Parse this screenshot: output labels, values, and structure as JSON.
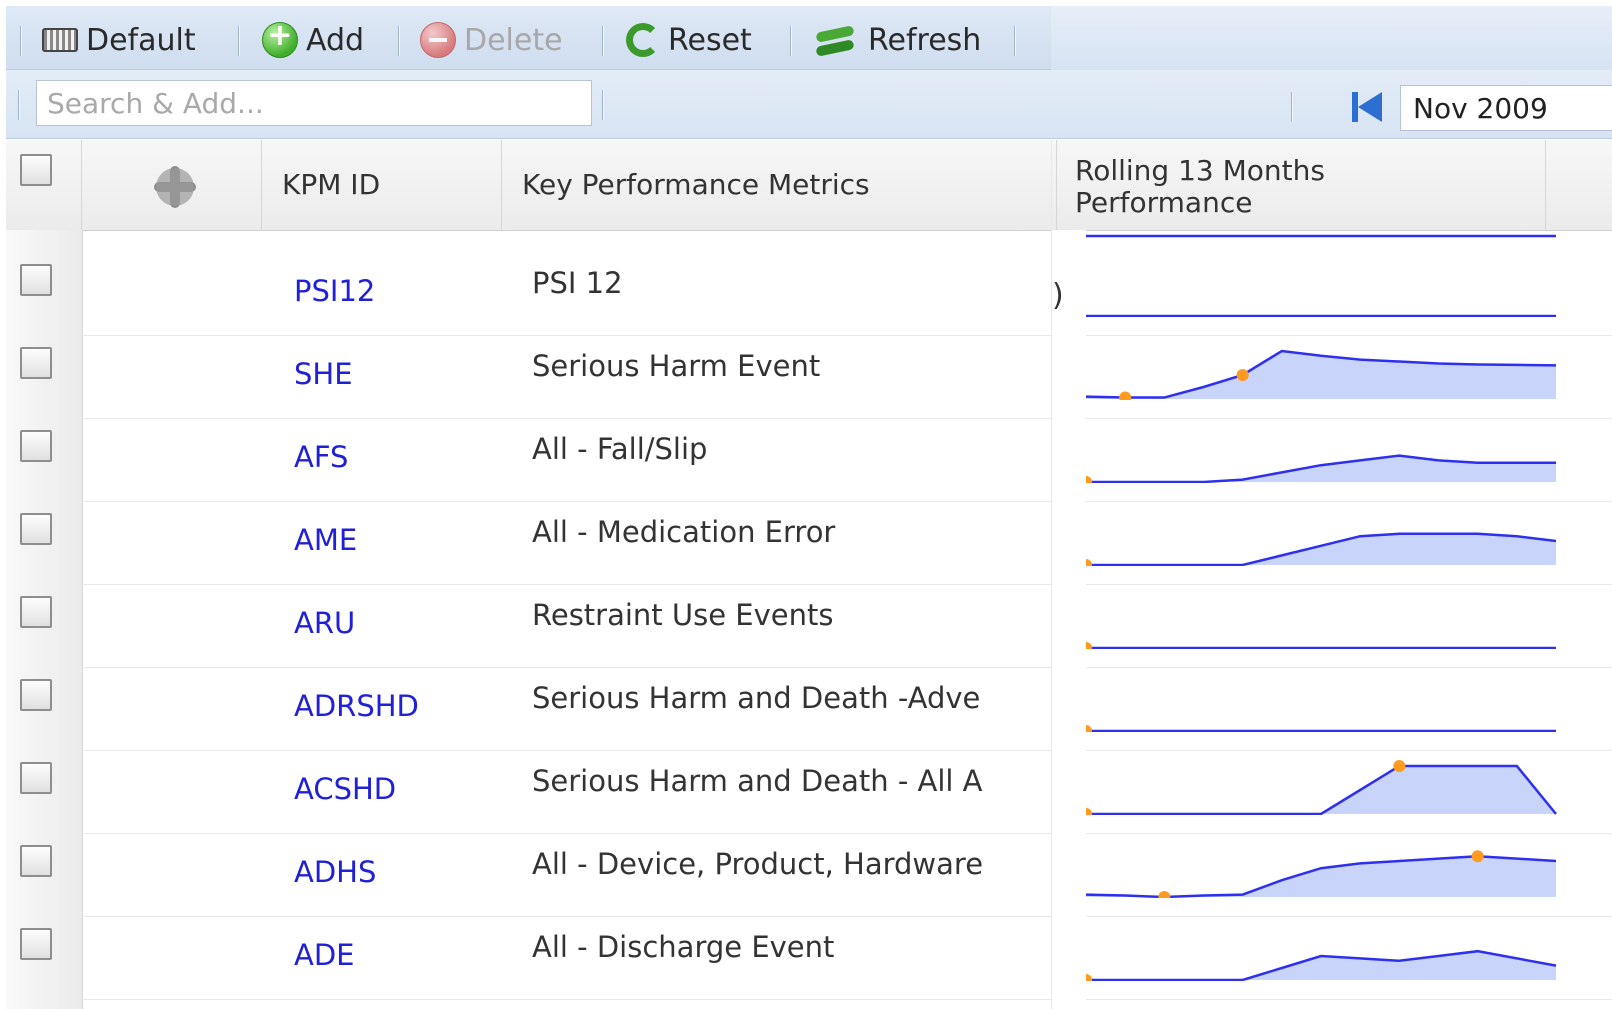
{
  "toolbar": {
    "default_label": "Default",
    "add_label": "Add",
    "delete_label": "Delete",
    "reset_label": "Reset",
    "refresh_label": "Refresh"
  },
  "search": {
    "placeholder": "Search & Add..."
  },
  "period": {
    "value": "Nov 2009"
  },
  "columns": {
    "kpm_id": "KPM ID",
    "metric": "Key Performance Metrics",
    "trend_line1": "Rolling 13 Months",
    "trend_line2": "Performance"
  },
  "stray_char": ")",
  "rows": [
    {
      "id": "PSI12",
      "name": "PSI 12",
      "trend": [
        0,
        0,
        0,
        0,
        0,
        0,
        0,
        0,
        0,
        0,
        0,
        0,
        0
      ],
      "markers": []
    },
    {
      "id": "SHE",
      "name": "Serious Harm Event",
      "trend": [
        0.05,
        0.03,
        0.03,
        0.25,
        0.5,
        1.0,
        0.9,
        0.82,
        0.78,
        0.74,
        0.72,
        0.71,
        0.7
      ],
      "markers": [
        1,
        4
      ]
    },
    {
      "id": "AFS",
      "name": "All - Fall/Slip",
      "trend": [
        0,
        0,
        0,
        0,
        0.05,
        0.2,
        0.35,
        0.45,
        0.55,
        0.45,
        0.4,
        0.4,
        0.4
      ],
      "markers": [
        0
      ]
    },
    {
      "id": "AME",
      "name": "All - Medication Error",
      "trend": [
        0,
        0,
        0,
        0,
        0,
        0.2,
        0.4,
        0.6,
        0.65,
        0.65,
        0.65,
        0.6,
        0.5
      ],
      "markers": [
        0
      ]
    },
    {
      "id": "ARU",
      "name": "Restraint Use Events",
      "trend": [
        0,
        0,
        0,
        0,
        0,
        0,
        0,
        0,
        0,
        0,
        0,
        0,
        0
      ],
      "markers": [
        0
      ]
    },
    {
      "id": "ADRSHD",
      "name": "Serious Harm and Death -Adve",
      "trend": [
        0,
        0,
        0,
        0,
        0,
        0,
        0,
        0,
        0,
        0,
        0,
        0,
        0
      ],
      "markers": [
        0
      ]
    },
    {
      "id": "ACSHD",
      "name": "Serious Harm and Death - All A",
      "trend": [
        0,
        0,
        0,
        0,
        0,
        0,
        0,
        0.5,
        1.0,
        1.0,
        1.0,
        1.0,
        0
      ],
      "markers": [
        0,
        8
      ]
    },
    {
      "id": "ADHS",
      "name": "All - Device, Product, Hardware",
      "trend": [
        0.05,
        0.03,
        0,
        0.03,
        0.05,
        0.35,
        0.6,
        0.7,
        0.75,
        0.8,
        0.85,
        0.8,
        0.75
      ],
      "markers": [
        2,
        10
      ]
    },
    {
      "id": "ADE",
      "name": "All - Discharge Event",
      "trend": [
        0,
        0,
        0,
        0,
        0,
        0.25,
        0.5,
        0.45,
        0.4,
        0.5,
        0.6,
        0.45,
        0.3
      ],
      "markers": [
        0
      ]
    }
  ],
  "colors": {
    "line": "#2f2ff0",
    "fill": "#c9d4fb",
    "marker": "#ff9a1f",
    "link": "#2020d8"
  }
}
